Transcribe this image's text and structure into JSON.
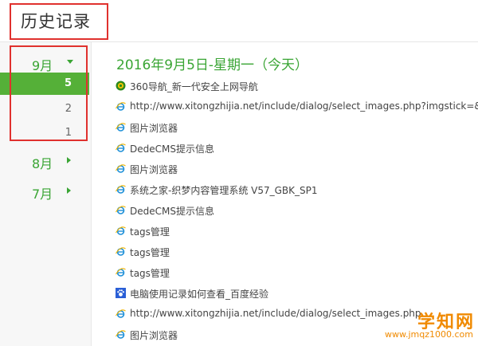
{
  "header": {
    "title": "历史记录"
  },
  "sidebar": {
    "months": [
      {
        "label": "9月",
        "expanded": true,
        "days": [
          {
            "label": "5",
            "active": true
          },
          {
            "label": "2",
            "active": false
          },
          {
            "label": "1",
            "active": false
          }
        ]
      },
      {
        "label": "8月",
        "expanded": false
      },
      {
        "label": "7月",
        "expanded": false
      }
    ]
  },
  "content": {
    "date_heading": "2016年9月5日-星期一（今天）",
    "entries": [
      {
        "icon": "360-nav-icon",
        "text": "360导航_新一代安全上网导航"
      },
      {
        "icon": "ie-page-icon",
        "text": "http://www.xitongzhijia.net/include/dialog/select_images.php?imgstick=&comeback"
      },
      {
        "icon": "ie-page-icon",
        "text": "图片浏览器"
      },
      {
        "icon": "ie-page-icon",
        "text": "DedeCMS提示信息"
      },
      {
        "icon": "ie-page-icon",
        "text": "图片浏览器"
      },
      {
        "icon": "ie-page-icon",
        "text": "系统之家-织梦内容管理系统 V57_GBK_SP1"
      },
      {
        "icon": "ie-page-icon",
        "text": "DedeCMS提示信息"
      },
      {
        "icon": "ie-page-icon",
        "text": "tags管理"
      },
      {
        "icon": "ie-page-icon",
        "text": "tags管理"
      },
      {
        "icon": "ie-page-icon",
        "text": "tags管理"
      },
      {
        "icon": "baidu-paw-icon",
        "text": "电脑使用记录如何查看_百度经验"
      },
      {
        "icon": "ie-page-icon",
        "text": "http://www.xitongzhijia.net/include/dialog/select_images.php"
      },
      {
        "icon": "ie-page-icon",
        "text": "图片浏览器"
      }
    ]
  },
  "watermark": {
    "title": "学知网",
    "url": "www.jmqz1000.com"
  },
  "colors": {
    "accent": "#3aa534",
    "active_day_bg": "#55b038",
    "highlight": "#e0312e",
    "watermark": "#f08a00"
  }
}
